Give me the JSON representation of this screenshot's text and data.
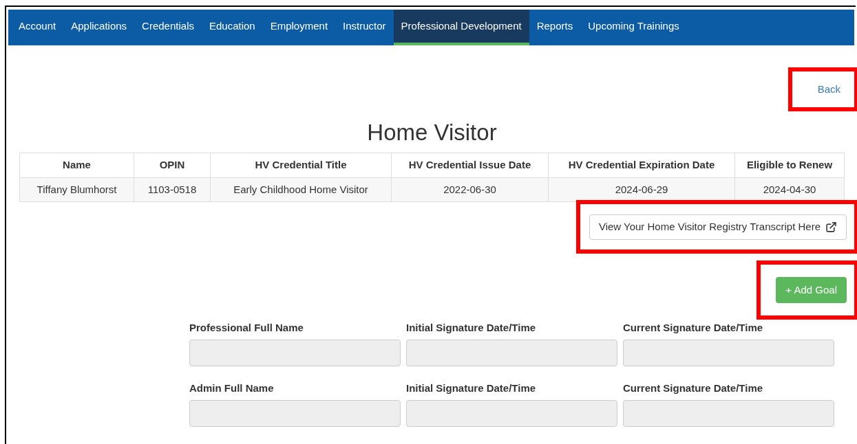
{
  "nav": {
    "tabs": [
      {
        "label": "Account",
        "selected": false
      },
      {
        "label": "Applications",
        "selected": false
      },
      {
        "label": "Credentials",
        "selected": false
      },
      {
        "label": "Education",
        "selected": false
      },
      {
        "label": "Employment",
        "selected": false
      },
      {
        "label": "Instructor",
        "selected": false
      },
      {
        "label": "Professional Development",
        "selected": true
      },
      {
        "label": "Reports",
        "selected": false
      },
      {
        "label": "Upcoming Trainings",
        "selected": false
      }
    ]
  },
  "back_link": {
    "label": "Back",
    "highlighted": true
  },
  "title": "Home Visitor",
  "table": {
    "columns": [
      "Name",
      "OPIN",
      "HV Credential Title",
      "HV Credential Issue Date",
      "HV Credential Expiration Date",
      "Eligible to Renew"
    ],
    "rows": [
      [
        "Tiffany Blumhorst",
        "1103-0518",
        "Early Childhood Home Visitor",
        "2022-06-30",
        "2024-06-29",
        "2024-04-30"
      ]
    ]
  },
  "transcript_button": {
    "label": "View Your Home Visitor Registry Transcript Here",
    "highlighted": true
  },
  "add_goal_button": {
    "label": "+ Add Goal",
    "highlighted": true
  },
  "signature_rows": [
    {
      "fields": [
        {
          "label": "Professional Full Name"
        },
        {
          "label": "Initial Signature Date/Time"
        },
        {
          "label": "Current Signature Date/Time"
        }
      ]
    },
    {
      "fields": [
        {
          "label": "Admin Full Name"
        },
        {
          "label": "Initial Signature Date/Time"
        },
        {
          "label": "Current Signature Date/Time"
        }
      ]
    }
  ]
}
